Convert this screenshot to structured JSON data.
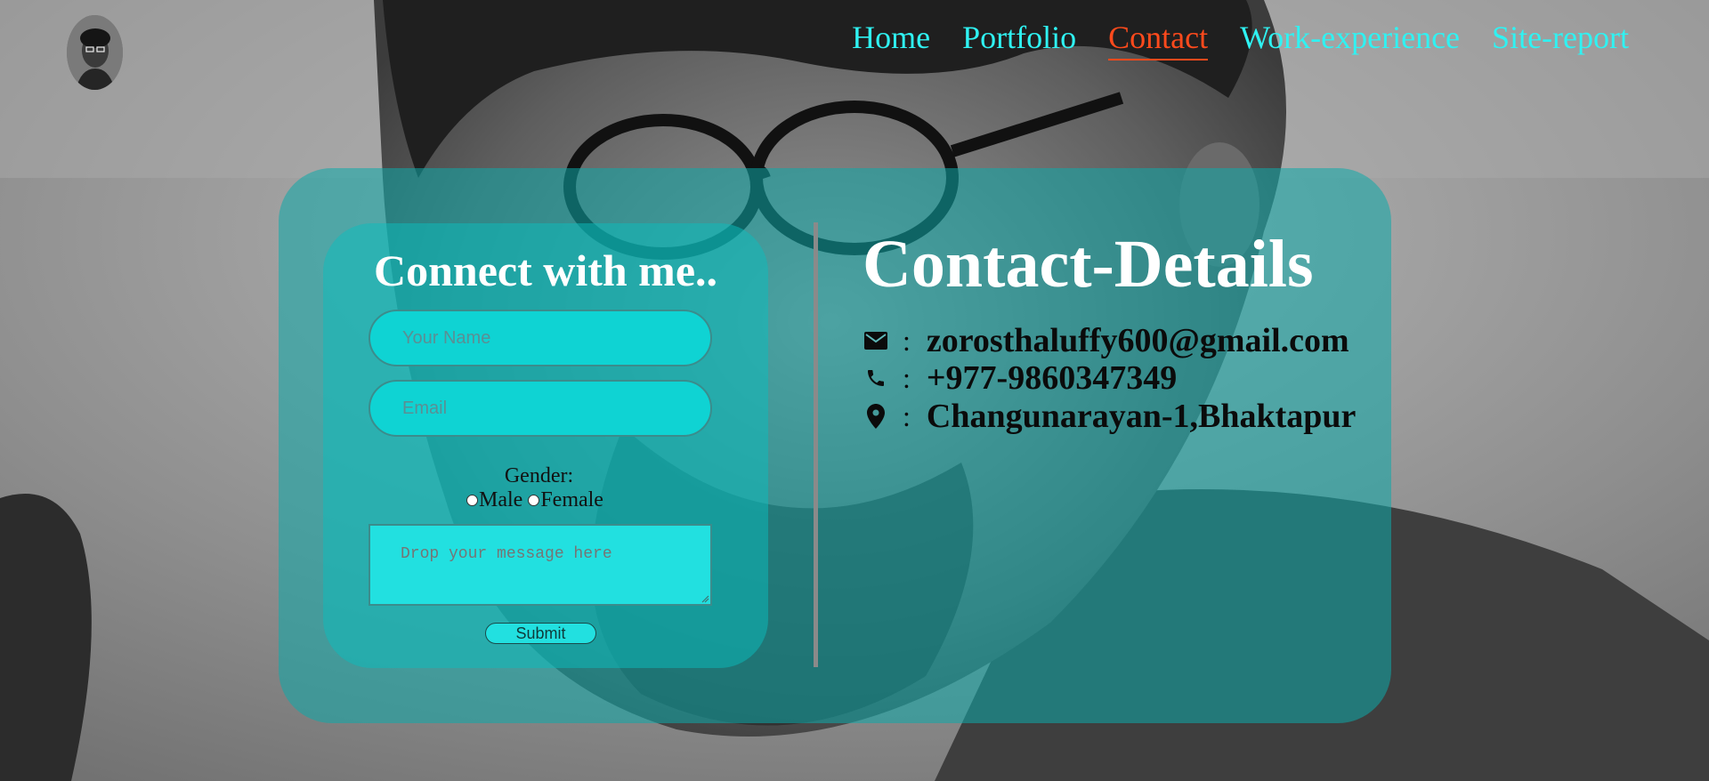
{
  "nav": {
    "items": [
      {
        "label": "Home",
        "active": false
      },
      {
        "label": "Portfolio",
        "active": false
      },
      {
        "label": "Contact",
        "active": true
      },
      {
        "label": "Work-experience",
        "active": false
      },
      {
        "label": "Site-report",
        "active": false
      }
    ],
    "link_color": "#2ff2f2",
    "active_color": "#ff4a1c"
  },
  "logo": {
    "icon": "avatar"
  },
  "form": {
    "title": "Connect with me..",
    "name_placeholder": "Your Name",
    "email_placeholder": "Email",
    "gender_label": "Gender:",
    "gender_options": [
      "Male",
      "Female"
    ],
    "message_placeholder": "Drop your message here",
    "submit_label": "Submit"
  },
  "details": {
    "title": "Contact-Details",
    "separator": ":",
    "email": {
      "icon": "mail-icon",
      "value": "zorosthaluffy600@gmail.com"
    },
    "phone": {
      "icon": "phone-icon",
      "value": "+977-9860347349"
    },
    "address": {
      "icon": "location-pin-icon",
      "value": "Changunarayan-1,Bhaktapur"
    }
  },
  "colors": {
    "panel": "#0caaaa",
    "field": "#0fd3d3"
  }
}
